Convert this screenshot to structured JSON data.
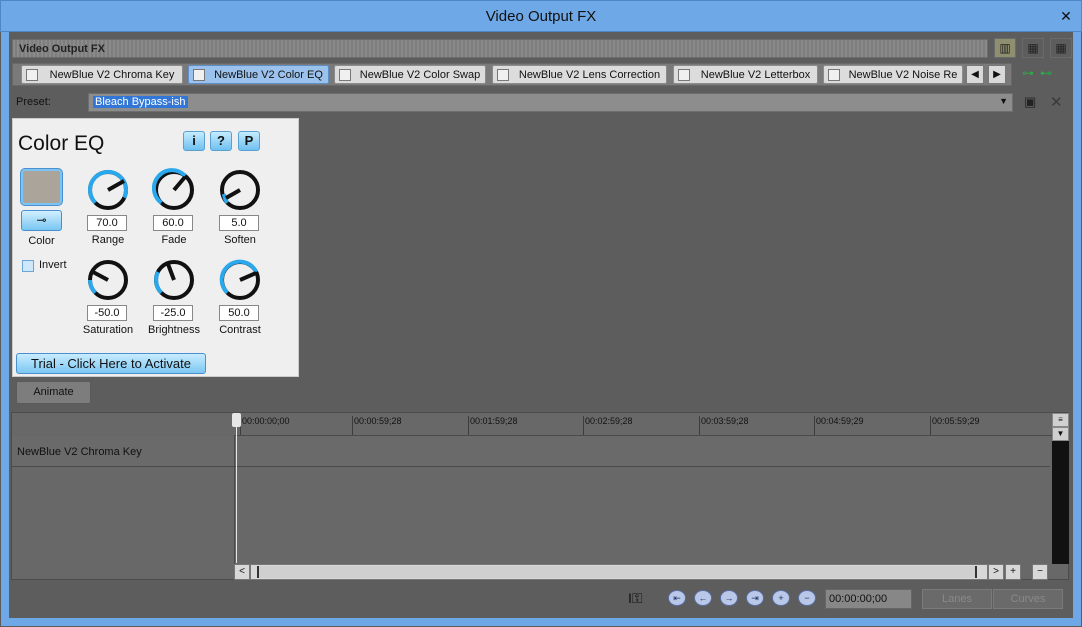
{
  "window": {
    "title": "Video Output FX",
    "close_glyph": "✕"
  },
  "fx_header": {
    "label": "Video Output FX"
  },
  "view_buttons": [
    {
      "name": "view-list-icon",
      "glyph": "▥"
    },
    {
      "name": "view-grid-icon",
      "glyph": "▦"
    },
    {
      "name": "view-tiles-icon",
      "glyph": "▦"
    }
  ],
  "tabs": [
    {
      "label": "NewBlue V2 Chroma Key",
      "active": false
    },
    {
      "label": "NewBlue V2 Color EQ",
      "active": true
    },
    {
      "label": "NewBlue V2 Color Swap",
      "active": false
    },
    {
      "label": "NewBlue V2 Lens Correction",
      "active": false
    },
    {
      "label": "NewBlue V2 Letterbox",
      "active": false
    },
    {
      "label": "NewBlue V2 Noise Re",
      "active": false
    }
  ],
  "preset": {
    "label": "Preset:",
    "value": "Bleach Bypass-ish",
    "arrow": "▼",
    "save_glyph": "▣",
    "delete_glyph": "✕"
  },
  "plugin": {
    "title": "Color EQ",
    "buttons": {
      "info": "i",
      "help": "?",
      "presets": "P"
    },
    "color_label": "Color",
    "picker_glyph": "⊸",
    "invert_label": "Invert",
    "trial_label": "Trial - Click Here to Activate",
    "knobs": [
      {
        "label": "Range",
        "value": "70.0"
      },
      {
        "label": "Fade",
        "value": "60.0"
      },
      {
        "label": "Soften",
        "value": "5.0"
      },
      {
        "label": "Saturation",
        "value": "-50.0"
      },
      {
        "label": "Brightness",
        "value": "-25.0"
      },
      {
        "label": "Contrast",
        "value": "50.0"
      }
    ]
  },
  "animate": {
    "label": "Animate"
  },
  "timeline": {
    "ticks": [
      "00:00:00;00",
      "00:00:59;28",
      "00:01:59;28",
      "00:02:59;28",
      "00:03:59;28",
      "00:04:59;29",
      "00:05:59;29"
    ],
    "track_name": "NewBlue V2 Chroma Key"
  },
  "transport": {
    "timecode": "00:00:00;00",
    "lanes_label": "Lanes",
    "curves_label": "Curves"
  }
}
